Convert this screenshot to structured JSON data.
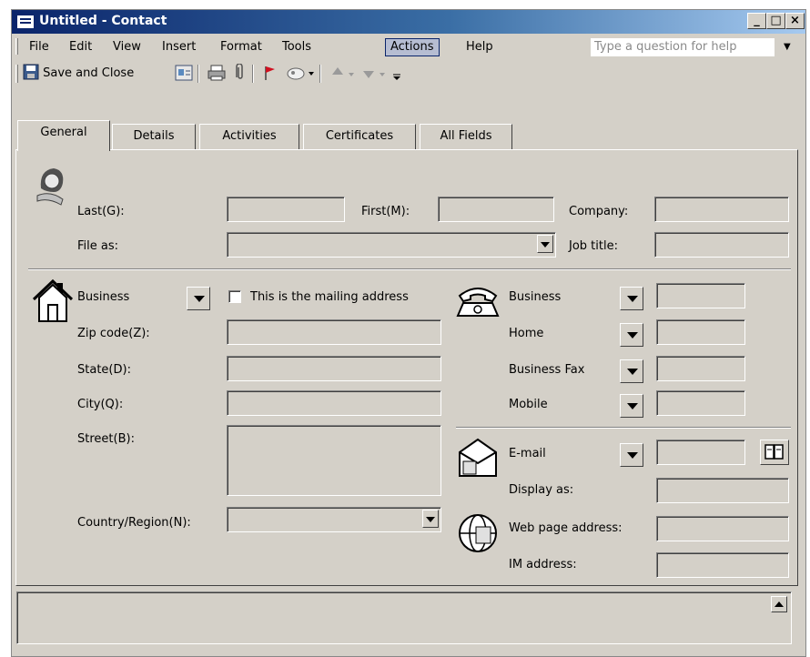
{
  "window": {
    "title": "Untitled - Contact",
    "controls": [
      "_",
      "□",
      "×"
    ]
  },
  "menu": {
    "items": [
      "File",
      "Edit",
      "View",
      "Insert",
      "Format",
      "Tools",
      "Actions",
      "Help"
    ],
    "active": "Actions",
    "help_placeholder": "Type a question for help"
  },
  "toolbar": {
    "save_close": "Save and Close",
    "icons": [
      "save-icon",
      "contact-card-icon",
      "print-icon",
      "paperclip-icon",
      "flag-icon",
      "categories-icon",
      "previous-icon",
      "next-icon",
      "toolbar-options-icon"
    ]
  },
  "tabs": [
    "General",
    "Details",
    "Activities",
    "Certificates",
    "All Fields"
  ],
  "selected_tab": "General",
  "name": {
    "last_label": "Last(G):",
    "first_label": "First(M):",
    "company_label": "Company:",
    "file_as_label": "File as:",
    "job_title_label": "Job title:"
  },
  "address": {
    "type": "Business",
    "mailing_checkbox": "This is the mailing address",
    "zip_label": "Zip code(Z):",
    "state_label": "State(D):",
    "city_label": "City(Q):",
    "street_label": "Street(B):",
    "country_label": "Country/Region(N):"
  },
  "phones": [
    "Business",
    "Home",
    "Business Fax",
    "Mobile"
  ],
  "internet": {
    "email_label": "E-mail",
    "display_as_label": "Display as:",
    "web_label": "Web page address:",
    "im_label": "IM address:"
  },
  "colors": {
    "title_start": "#0a246a",
    "title_end": "#a6caf0",
    "face": "#d4d0c8"
  }
}
